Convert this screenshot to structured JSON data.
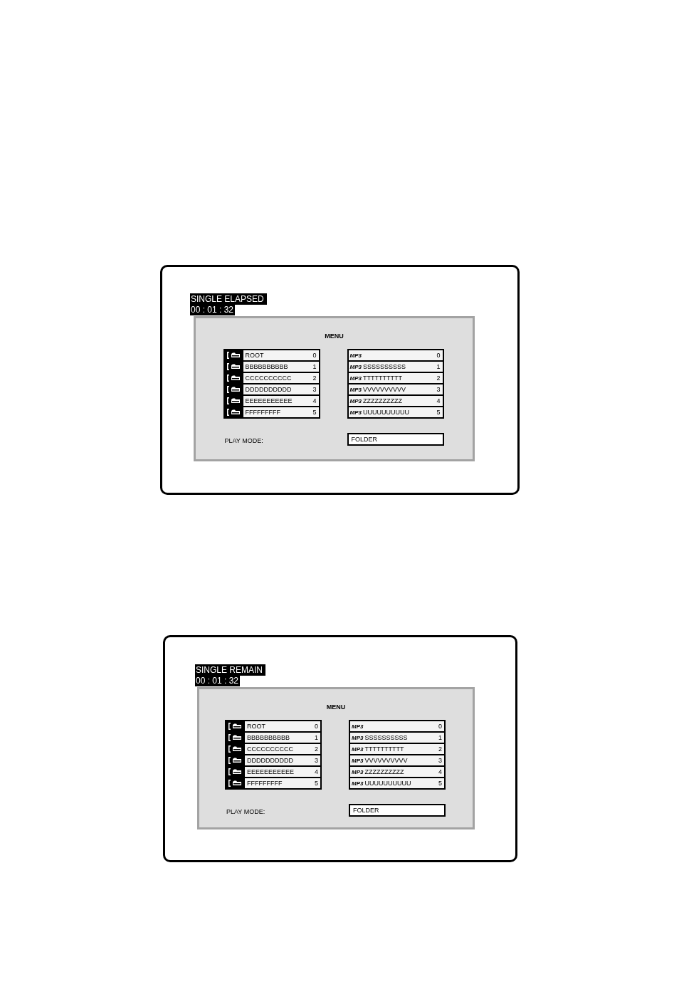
{
  "screens": [
    {
      "status": {
        "mode": "SINGLE ELAPSED",
        "time": "00 : 01 : 32"
      },
      "menu": {
        "title": "MENU",
        "folders": [
          {
            "name": "ROOT",
            "number": "0"
          },
          {
            "name": "BBBBBBBBBB",
            "number": "1"
          },
          {
            "name": "CCCCCCCCCC",
            "number": "2"
          },
          {
            "name": "DDDDDDDDDD",
            "number": "3"
          },
          {
            "name": "EEEEEEEEEEE",
            "number": "4"
          },
          {
            "name": "FFFFFFFFF",
            "number": "5"
          }
        ],
        "files": [
          {
            "format": "MP3",
            "number": "0"
          },
          {
            "format": "MP3",
            "name": "SSSSSSSSSS",
            "number": "1"
          },
          {
            "format": "MP3",
            "name": "TTTTTTTTTT",
            "number": "2"
          },
          {
            "format": "MP3",
            "name": "VVVVVVVVVV",
            "number": "3"
          },
          {
            "format": "MP3",
            "name": "ZZZZZZZZZZ",
            "number": "4"
          },
          {
            "format": "MP3",
            "name": "UUUUUUUUUU",
            "number": "5"
          }
        ],
        "play_mode": {
          "label": "PLAY MODE:",
          "value": "FOLDER"
        }
      }
    },
    {
      "status": {
        "mode": "SINGLE REMAIN",
        "time": "00 : 01 : 32"
      },
      "menu": {
        "title": "MENU",
        "folders": [
          {
            "name": "ROOT",
            "number": "0"
          },
          {
            "name": "BBBBBBBBBB",
            "number": "1"
          },
          {
            "name": "CCCCCCCCCC",
            "number": "2"
          },
          {
            "name": "DDDDDDDDDD",
            "number": "3"
          },
          {
            "name": "EEEEEEEEEEE",
            "number": "4"
          },
          {
            "name": "FFFFFFFFF",
            "number": "5"
          }
        ],
        "files": [
          {
            "format": "MP3",
            "number": "0"
          },
          {
            "format": "MP3",
            "name": "SSSSSSSSSS",
            "number": "1"
          },
          {
            "format": "MP3",
            "name": "TTTTTTTTTT",
            "number": "2"
          },
          {
            "format": "MP3",
            "name": "VVVVVVVVVV",
            "number": "3"
          },
          {
            "format": "MP3",
            "name": "ZZZZZZZZZZ",
            "number": "4"
          },
          {
            "format": "MP3",
            "name": "UUUUUUUUUU",
            "number": "5"
          }
        ],
        "play_mode": {
          "label": "PLAY MODE:",
          "value": "FOLDER"
        }
      }
    }
  ]
}
